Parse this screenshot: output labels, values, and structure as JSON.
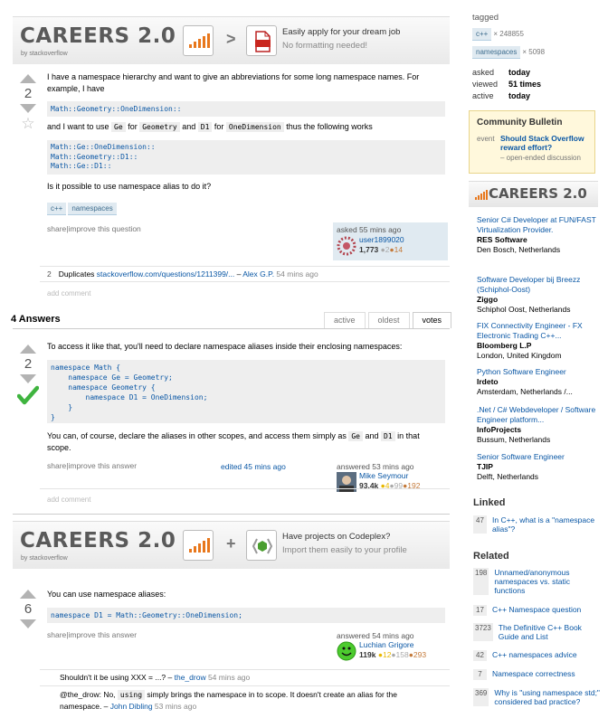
{
  "banner1": {
    "careers": "CAREERS 2.0",
    "by": "by stackoverflow",
    "symbol": ">",
    "title": "Easily apply for your dream job",
    "subtitle": "No formatting needed!"
  },
  "question": {
    "votes": "2",
    "p1": "I have a namespace hierarchy and want to give an abbreviations for some long namespace names. For example, I have",
    "code1": "Math::Geometry::OneDimension::",
    "p2a": "and I want to use ",
    "p2b": "Ge",
    "p2c": " for ",
    "p2d": "Geometry",
    "p2e": " and ",
    "p2f": "D1",
    "p2g": " for ",
    "p2h": "OneDimension",
    "p2i": " thus the following works",
    "code2": [
      "Math::Ge::OneDimension::",
      "Math::Geometry::D1::",
      "Math::Ge::D1::"
    ],
    "p3": "Is it possible to use namespace alias to do it?",
    "tags": [
      "c++",
      "namespaces"
    ],
    "actions": "share|improve this question",
    "asked": "asked 55 mins ago",
    "user": "user1899020",
    "rep": "1,773",
    "silver": "●2",
    "bronze": "●14",
    "comment_count": "2",
    "comment_text": "Duplicates ",
    "comment_link": "stackoverflow.com/questions/1211399/...",
    "comment_dash": " – ",
    "comment_user": "Alex G.P.",
    "comment_time": " 54 mins ago",
    "add_comment": "add comment"
  },
  "answers_header": {
    "title": "4 Answers",
    "tabs": [
      "active",
      "oldest",
      "votes"
    ]
  },
  "answer1": {
    "votes": "2",
    "p1": "To access it like that, you'll need to declare namespace aliases inside their enclosing namespaces:",
    "code": [
      "namespace Math {",
      "    namespace Ge = Geometry;",
      "    namespace Geometry {",
      "        namespace D1 = OneDimension;",
      "    }",
      "}"
    ],
    "p2a": "You can, of course, declare the aliases in other scopes, and access them simply as ",
    "p2b": "Ge",
    "p2c": " and ",
    "p2d": "D1",
    "p2e": " in that scope.",
    "actions": "share|improve this answer",
    "edited": "edited 45 mins ago",
    "answered": "answered 53 mins ago",
    "user": "Mike Seymour",
    "rep": "93.4k",
    "gold": "●4",
    "silver": "●99",
    "bronze": "●192",
    "add_comment": "add comment"
  },
  "banner2": {
    "careers": "CAREERS 2.0",
    "by": "by stackoverflow",
    "symbol": "+",
    "title": "Have projects on Codeplex?",
    "subtitle": "Import them easily to your profile"
  },
  "answer2": {
    "votes": "6",
    "p1": "You can use namespace aliases:",
    "code": "namespace D1 = Math::Geometry::OneDimension;",
    "actions": "share|improve this answer",
    "answered": "answered 54 mins ago",
    "user": "Luchian Grigore",
    "rep": "119k",
    "gold": "●12",
    "silver": "●158",
    "bronze": "●293",
    "c1_text": "Shouldn't it be using XXX = ...? – ",
    "c1_user": "the_drow",
    "c1_time": " 54 mins ago",
    "c2_a": "@the_drow: No, ",
    "c2_b": "using",
    "c2_c": " simply brings the namespace in to scope. It doesn't create an alias for the namespace. – ",
    "c2_user": "John Dibling",
    "c2_time": " 53 mins ago"
  },
  "sidebar": {
    "tagged": "tagged",
    "tags": [
      {
        "name": "c++",
        "count": "× 248855"
      },
      {
        "name": "namespaces",
        "count": "× 5098"
      }
    ],
    "stats": [
      {
        "label": "asked",
        "value": "today"
      },
      {
        "label": "viewed",
        "value": "51 times"
      },
      {
        "label": "active",
        "value": "today"
      }
    ],
    "bulletin_title": "Community Bulletin",
    "bulletin_event": "event",
    "bulletin_link": "Should Stack Overflow reward effort?",
    "bulletin_note": "– open-ended discussion",
    "careers_title": "CAREERS 2.0",
    "jobs": [
      {
        "title": "Senior C# Developer at FUN/FAST Virtualization Provider.",
        "company": "RES Software",
        "location": "Den Bosch, Netherlands"
      },
      {
        "title": "Software Developer bij Breezz (Schiphol-Oost)",
        "company": "Ziggo",
        "location": "Schiphol Oost, Netherlands"
      },
      {
        "title": "FIX Connectivity Engineer - FX Electronic Trading C++...",
        "company": "Bloomberg L.P",
        "location": "London, United Kingdom"
      },
      {
        "title": "Python Software Engineer",
        "company": "Irdeto",
        "location": "Amsterdam, Netherlands /..."
      },
      {
        "title": ".Net / C# Webdeveloper / Software Engineer platform...",
        "company": "InfoProjects",
        "location": "Bussum, Netherlands"
      },
      {
        "title": "Senior Software Engineer",
        "company": "TJIP",
        "location": "Delft, Netherlands"
      }
    ],
    "linked_title": "Linked",
    "linked": [
      {
        "count": "47",
        "title": "In C++, what is a \"namespace alias\"?"
      }
    ],
    "related_title": "Related",
    "related": [
      {
        "count": "198",
        "title": "Unnamed/anonymous namespaces vs. static functions"
      },
      {
        "count": "17",
        "title": "C++ Namespace question"
      },
      {
        "count": "3723",
        "title": "The Definitive C++ Book Guide and List"
      },
      {
        "count": "42",
        "title": "C++ namespaces advice"
      },
      {
        "count": "7",
        "title": "Namespace correctness"
      },
      {
        "count": "369",
        "title": "Why is \"using namespace std;\" considered bad practice?"
      }
    ]
  },
  "colors": {
    "link": "#0a57a5",
    "accent": "#e8771c",
    "tag_bg": "#e0eaf1",
    "accepted": "#3fb43f",
    "bulletin_bg": "#fff8dc"
  }
}
